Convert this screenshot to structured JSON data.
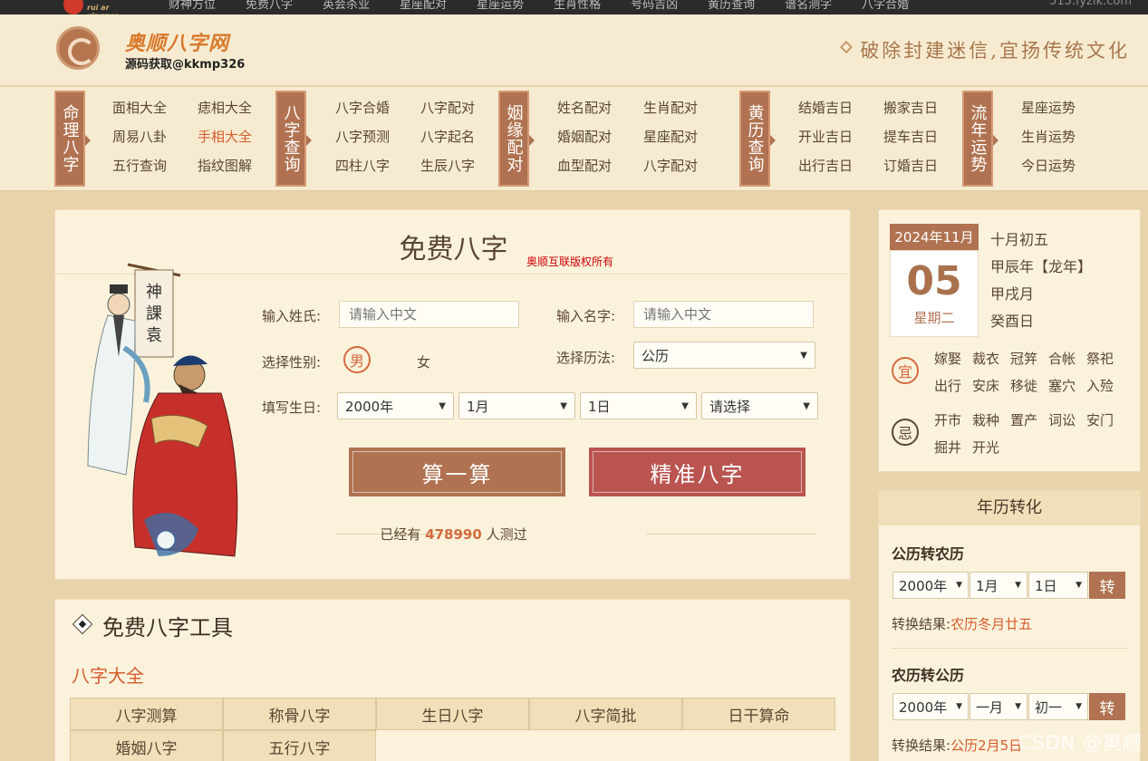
{
  "topnav": {
    "logo_sub": "rui ar xingzuo",
    "items": [
      "财神方位",
      "免费八字",
      "英会杀业",
      "星座配对",
      "星座运势",
      "生肖性格",
      "号码吉凶",
      "黄历查询",
      "谱名测字",
      "八字合婚"
    ],
    "domain": "515.fyzik.com"
  },
  "header": {
    "brand_title": "奥顺八字网",
    "brand_sub": "源码获取@kkmp326",
    "slogan": "破除封建迷信,宜扬传统文化"
  },
  "catnav": {
    "groups": [
      {
        "label": "命理八字",
        "links": [
          "面相大全",
          "痣相大全",
          "周易八卦",
          "手相大全",
          "五行查询",
          "指纹图解"
        ]
      },
      {
        "label": "八字查询",
        "links": [
          "八字合婚",
          "八字配对",
          "八字预测",
          "八字起名",
          "四柱八字",
          "生辰八字"
        ]
      },
      {
        "label": "姻缘配对",
        "links": [
          "姓名配对",
          "生肖配对",
          "婚姻配对",
          "星座配对",
          "血型配对",
          "八字配对"
        ]
      },
      {
        "label": "黄历查询",
        "links": [
          "结婚吉日",
          "搬家吉日",
          "开业吉日",
          "提车吉日",
          "出行吉日",
          "订婚吉日"
        ]
      },
      {
        "label": "流年运势",
        "links": [
          "星座运势",
          "生肖运势",
          "今日运势"
        ]
      }
    ]
  },
  "main": {
    "title": "免费八字",
    "copyright": "奥顺互联版权所有",
    "surname_label": "输入姓氏:",
    "surname_placeholder": "请输入中文",
    "name_label": "输入名字:",
    "name_placeholder": "请输入中文",
    "gender_label": "选择性别:",
    "gender_male": "男",
    "gender_female": "女",
    "calendar_label": "选择历法:",
    "calendar_value": "公历",
    "birth_label": "填写生日:",
    "birth_year": "2000年",
    "birth_month": "1月",
    "birth_day": "1日",
    "birth_hour": "请选择",
    "btn_calc": "算一算",
    "btn_precise": "精准八字",
    "tested_prefix": "已经有",
    "tested_count": "478990",
    "tested_suffix": "人测过"
  },
  "tools": {
    "title": "免费八字工具",
    "section": "八字大全",
    "items": [
      "八字测算",
      "称骨八字",
      "生日八字",
      "八字简批",
      "日干算命",
      "婚姻八字",
      "五行八字"
    ]
  },
  "calendar": {
    "month": "2024年11月",
    "day": "05",
    "weekday": "星期二",
    "lunar": "十月初五",
    "year_gz": "甲辰年【龙年】",
    "month_gz": "甲戌月",
    "day_gz": "癸酉日",
    "yi_label": "宜",
    "yi": [
      "嫁娶",
      "裁衣",
      "冠笄",
      "合帐",
      "祭祀",
      "出行",
      "安床",
      "移徙",
      "塞穴",
      "入殓"
    ],
    "ji_label": "忌",
    "ji": [
      "开市",
      "栽种",
      "置产",
      "词讼",
      "安门",
      "掘井",
      "开光"
    ]
  },
  "conversion": {
    "title": "年历转化",
    "solar_to_lunar": "公历转农历",
    "s_year": "2000年",
    "s_month": "1月",
    "s_day": "1日",
    "convert_btn": "转",
    "result_label": "转换结果:",
    "s_result": "农历冬月廿五",
    "lunar_to_solar": "农历转公历",
    "l_year": "2000年",
    "l_month": "一月",
    "l_day": "初一",
    "l_result": "公历2月5日"
  },
  "watermark": "CSDN @奥顺",
  "colors": {
    "accent": "#b07250",
    "accent_red": "#b95450",
    "highlight": "#d65c2c"
  }
}
